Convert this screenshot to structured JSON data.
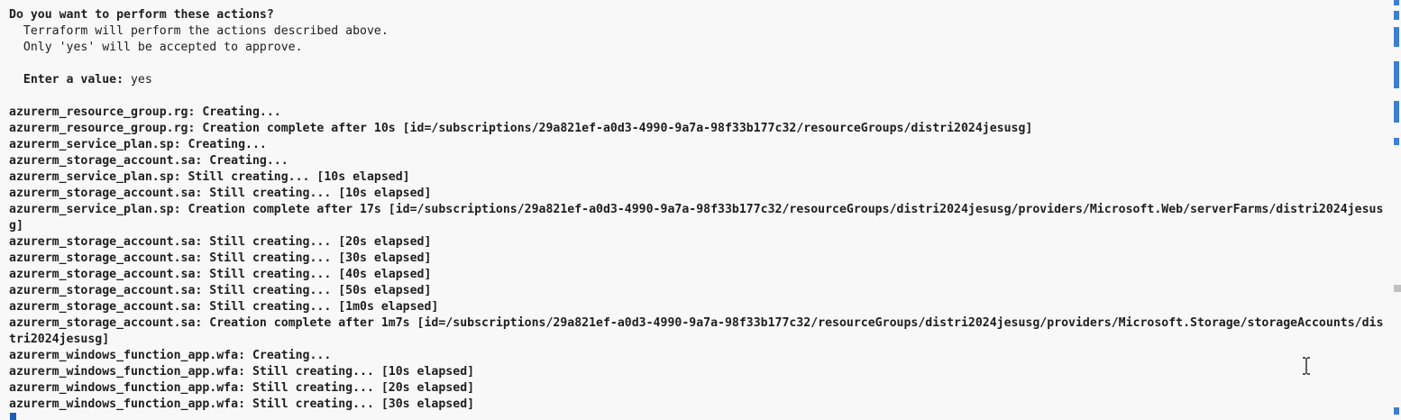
{
  "terminal": {
    "lines": [
      {
        "text": "Do you want to perform these actions?",
        "bold": true
      },
      {
        "text": "  Terraform will perform the actions described above."
      },
      {
        "text": "  Only 'yes' will be accepted to approve."
      },
      {
        "text": ""
      },
      {
        "label": "  Enter a value:",
        "value": " yes"
      },
      {
        "text": ""
      },
      {
        "text": "azurerm_resource_group.rg: Creating...",
        "bold": true
      },
      {
        "text": "azurerm_resource_group.rg: Creation complete after 10s [id=/subscriptions/29a821ef-a0d3-4990-9a7a-98f33b177c32/resourceGroups/distri2024jesusg]",
        "bold": true
      },
      {
        "text": "azurerm_service_plan.sp: Creating...",
        "bold": true
      },
      {
        "text": "azurerm_storage_account.sa: Creating...",
        "bold": true
      },
      {
        "text": "azurerm_service_plan.sp: Still creating... [10s elapsed]",
        "bold": true
      },
      {
        "text": "azurerm_storage_account.sa: Still creating... [10s elapsed]",
        "bold": true
      },
      {
        "text": "azurerm_service_plan.sp: Creation complete after 17s [id=/subscriptions/29a821ef-a0d3-4990-9a7a-98f33b177c32/resourceGroups/distri2024jesusg/providers/Microsoft.Web/serverFarms/distri2024jesus",
        "bold": true
      },
      {
        "text": "g]",
        "bold": true
      },
      {
        "text": "azurerm_storage_account.sa: Still creating... [20s elapsed]",
        "bold": true
      },
      {
        "text": "azurerm_storage_account.sa: Still creating... [30s elapsed]",
        "bold": true
      },
      {
        "text": "azurerm_storage_account.sa: Still creating... [40s elapsed]",
        "bold": true
      },
      {
        "text": "azurerm_storage_account.sa: Still creating... [50s elapsed]",
        "bold": true
      },
      {
        "text": "azurerm_storage_account.sa: Still creating... [1m0s elapsed]",
        "bold": true
      },
      {
        "text": "azurerm_storage_account.sa: Creation complete after 1m7s [id=/subscriptions/29a821ef-a0d3-4990-9a7a-98f33b177c32/resourceGroups/distri2024jesusg/providers/Microsoft.Storage/storageAccounts/dis",
        "bold": true
      },
      {
        "text": "tri2024jesusg]",
        "bold": true
      },
      {
        "text": "azurerm_windows_function_app.wfa: Creating...",
        "bold": true
      },
      {
        "text": "azurerm_windows_function_app.wfa: Still creating... [10s elapsed]",
        "bold": true
      },
      {
        "text": "azurerm_windows_function_app.wfa: Still creating... [20s elapsed]",
        "bold": true
      },
      {
        "text": "azurerm_windows_function_app.wfa: Still creating... [30s elapsed]",
        "bold": true
      }
    ]
  },
  "icons": {
    "cursor": "text-cursor-block",
    "pointer": "i-beam-cursor-icon"
  },
  "colors": {
    "background": "#f8f8f8",
    "text": "#1e1e1e",
    "accent": "#1a5fb4"
  }
}
